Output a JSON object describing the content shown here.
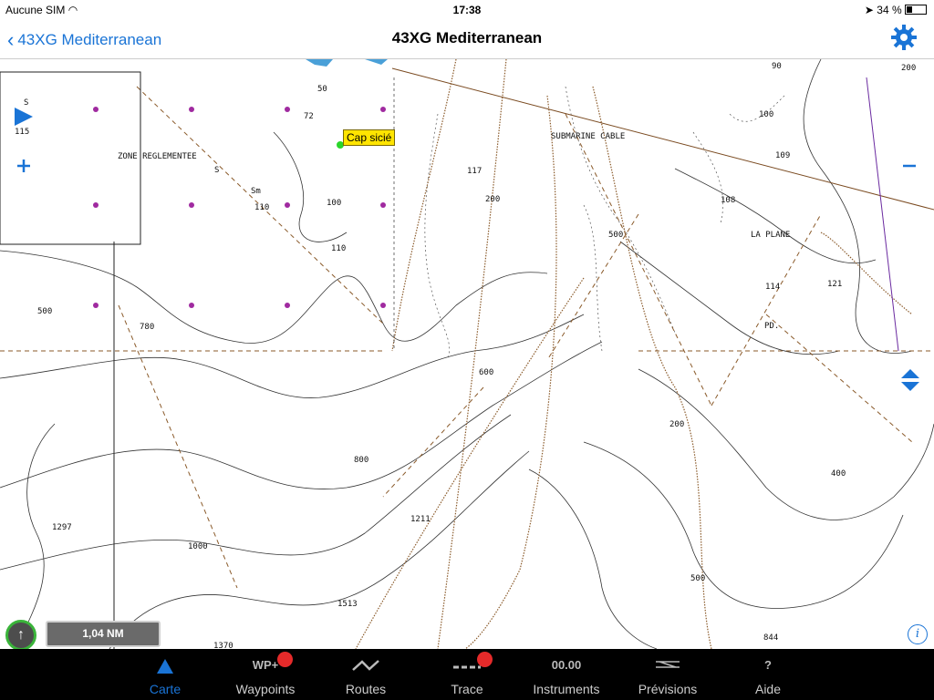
{
  "status": {
    "carrier": "Aucune SIM",
    "time": "17:38",
    "battery": "34 %"
  },
  "nav": {
    "back_label": "43XG Mediterranean",
    "title": "43XG Mediterranean"
  },
  "map": {
    "waypoint_label": "Cap sicié",
    "labels": {
      "zone": "ZONE REGLEMENTEE",
      "cable": "SUBMARINE CABLE",
      "plane": "LA PLANE",
      "pd": "PD."
    },
    "depths": [
      "90",
      "200",
      "50",
      "72",
      "100",
      "109",
      "117",
      "100",
      "200",
      "108",
      "110",
      "110",
      "500",
      "121",
      "114",
      "500",
      "780",
      "600",
      "200",
      "800",
      "400",
      "1211",
      "1297",
      "1000",
      "500",
      "1513",
      "1370",
      "844",
      "115",
      "S",
      "S",
      "Sm"
    ],
    "scale": "1,04 NM",
    "info": "i"
  },
  "tabs": [
    {
      "label": "Carte",
      "icon": ""
    },
    {
      "label": "Waypoints",
      "icon": "WP+"
    },
    {
      "label": "Routes",
      "icon": ""
    },
    {
      "label": "Trace",
      "icon": ""
    },
    {
      "label": "Instruments",
      "icon": "00.00"
    },
    {
      "label": "Prévisions",
      "icon": ""
    },
    {
      "label": "Aide",
      "icon": "?"
    }
  ],
  "colors": {
    "accent": "#1a74d6",
    "badge": "#e52a2a",
    "waypoint_flag": "#ffe400"
  }
}
